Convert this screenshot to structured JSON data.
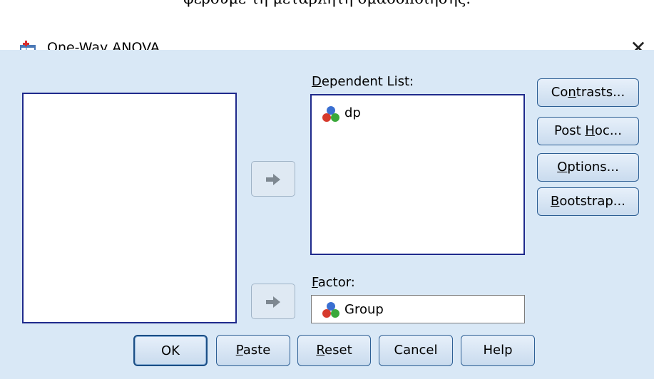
{
  "caption": "φέρουμε τη μεταβλητή ομαδοποίησης.",
  "window": {
    "title": "One-Way ANOVA",
    "close_glyph": "✕"
  },
  "labels": {
    "dependent_list": {
      "pre": "",
      "ul": "D",
      "post": "ependent List:"
    },
    "factor": {
      "pre": "",
      "ul": "F",
      "post": "actor:"
    }
  },
  "dependent_list": {
    "items": [
      {
        "label": "dp",
        "icon": "nominal-variable-icon"
      }
    ]
  },
  "factor": {
    "value": "Group",
    "icon": "nominal-variable-icon"
  },
  "side_buttons": [
    {
      "pre": "Co",
      "ul": "n",
      "post": "trasts..."
    },
    {
      "pre": "Post ",
      "ul": "H",
      "post": "oc..."
    },
    {
      "pre": "",
      "ul": "O",
      "post": "ptions..."
    },
    {
      "pre": "",
      "ul": "B",
      "post": "ootstrap..."
    }
  ],
  "bottom_buttons": [
    {
      "pre": "OK",
      "ul": "",
      "post": ""
    },
    {
      "pre": "",
      "ul": "P",
      "post": "aste"
    },
    {
      "pre": "",
      "ul": "R",
      "post": "eset"
    },
    {
      "pre": "Cancel",
      "ul": "",
      "post": ""
    },
    {
      "pre": "Help",
      "ul": "",
      "post": ""
    }
  ],
  "icons": [
    "app-icon",
    "close-icon",
    "arrow-right-icon",
    "nominal-variable-icon"
  ]
}
